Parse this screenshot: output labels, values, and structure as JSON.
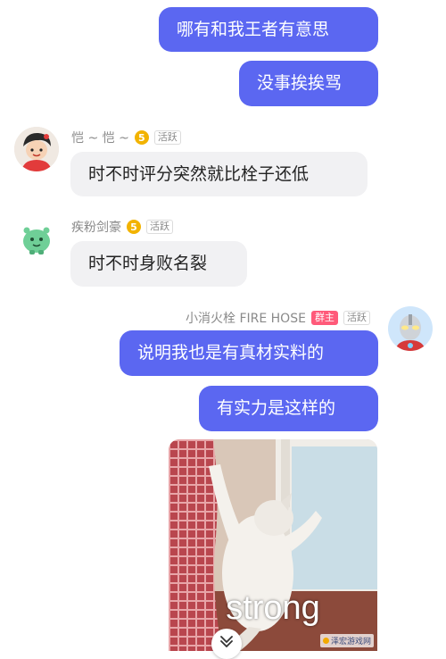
{
  "messages": [
    {
      "text": "哪有和我王者有意思",
      "side": "right"
    },
    {
      "text": "没事挨挨骂",
      "side": "right"
    },
    {
      "sender": "恺 ~ 恺 ~",
      "level": "5",
      "tag": "活跃",
      "text": "时不时评分突然就比栓子还低"
    },
    {
      "sender": "疾粉剑豪",
      "level": "5",
      "tag": "活跃",
      "text": "时不时身败名裂"
    },
    {
      "sender": "小消火栓 FIRE HOSE",
      "role": "群主",
      "tag": "活跃",
      "text": "说明我也是有真材实料的"
    },
    {
      "text": "有实力是这样的",
      "side": "right"
    }
  ],
  "image_message": {
    "caption": "strong",
    "icon": "cat-reaching-window-image"
  },
  "watermark": {
    "text": "泽宏游戏网"
  },
  "colors": {
    "my_bubble": "#5B67F1",
    "their_bubble": "#f1f1f3",
    "level_badge": "#f2b300",
    "owner_tag": "#ff5a7a"
  }
}
